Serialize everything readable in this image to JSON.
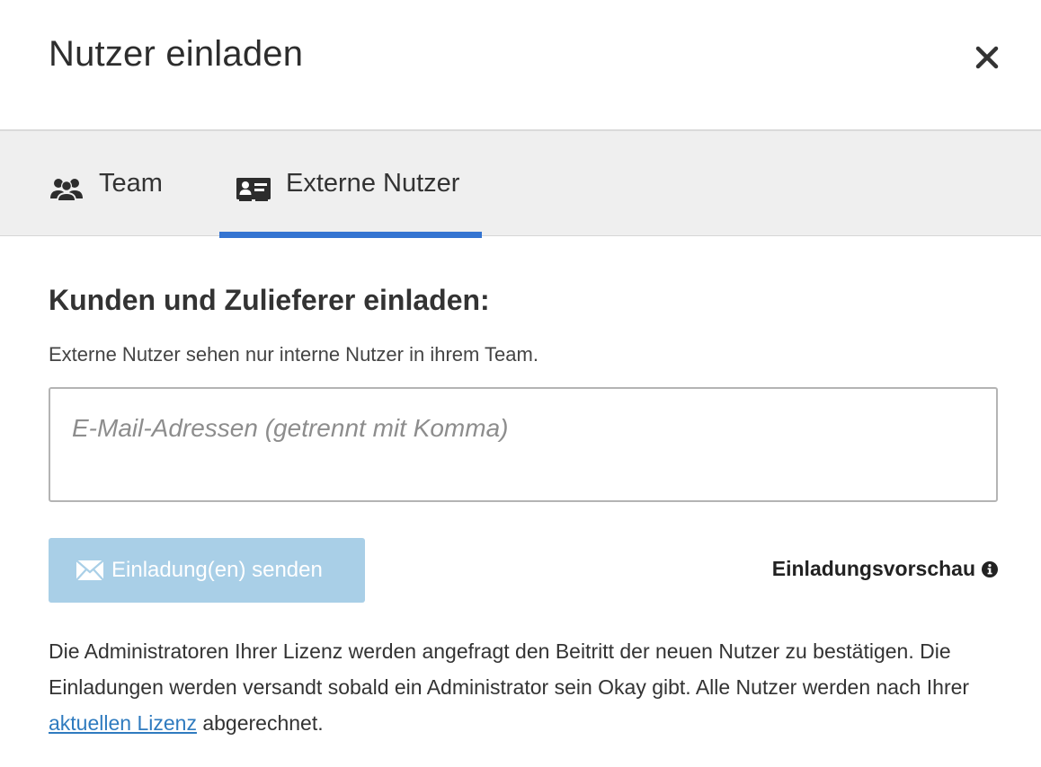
{
  "dialog": {
    "title": "Nutzer einladen",
    "close_icon": "close-icon"
  },
  "tabs": [
    {
      "label": "Team",
      "icon": "users-icon",
      "active": false
    },
    {
      "label": "Externe Nutzer",
      "icon": "contact-card-icon",
      "active": true
    }
  ],
  "form": {
    "heading": "Kunden und Zulieferer einladen:",
    "description": "Externe Nutzer sehen nur interne Nutzer in ihrem Team.",
    "email_placeholder": "E-Mail-Adressen (getrennt mit Komma)",
    "email_value": ""
  },
  "actions": {
    "send_label": "Einladung(en) senden",
    "send_icon": "envelope-icon",
    "preview_label": "Einladungsvorschau",
    "preview_icon": "info-icon"
  },
  "footer": {
    "text_before_link": "Die Administratoren Ihrer Lizenz werden angefragt den Beitritt der neuen Nutzer zu bestätigen. Die Einladungen werden versandt sobald ein Administrator sein Okay gibt. Alle Nutzer werden nach Ihrer ",
    "link_text": "aktuellen Lizenz",
    "text_after_link": " abgerechnet."
  },
  "colors": {
    "accent": "#3474d1",
    "button_disabled": "#a9cfe7",
    "link": "#2f7bbf",
    "tabbar_bg": "#efefef"
  }
}
